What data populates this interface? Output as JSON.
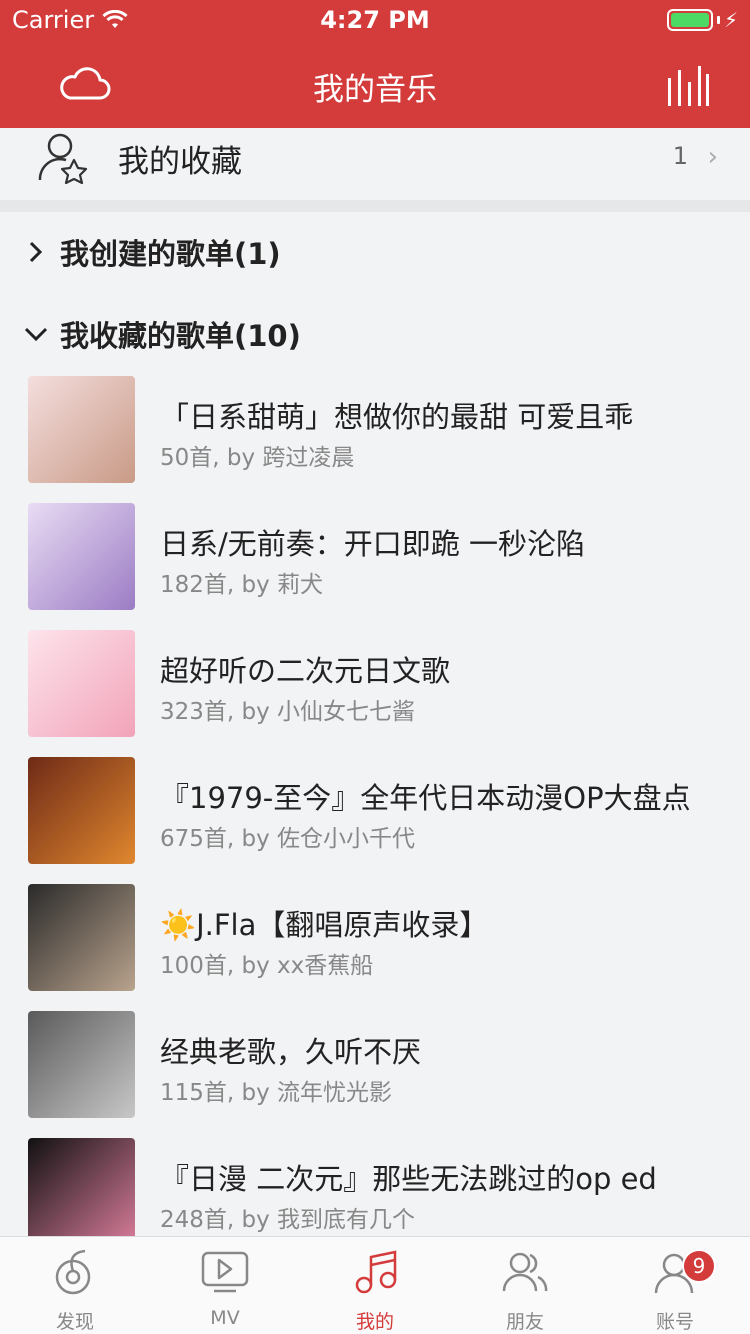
{
  "status": {
    "carrier": "Carrier",
    "time": "4:27 PM"
  },
  "nav": {
    "title": "我的音乐"
  },
  "favorites": {
    "label": "我的收藏",
    "count": "1"
  },
  "sections": {
    "created": "我创建的歌单(1)",
    "collected": "我收藏的歌单(10)"
  },
  "playlists": [
    {
      "title": "「日系甜萌」想做你的最甜 可爱且乖",
      "sub": "50首, by 跨过凌晨",
      "cover_colors": [
        "#f4dede",
        "#c99a86"
      ]
    },
    {
      "title": "日系/无前奏：开口即跪 一秒沦陷",
      "sub": "182首, by 莉犬",
      "cover_colors": [
        "#e9dcf4",
        "#9b7cc4"
      ]
    },
    {
      "title": "超好听の二次元日文歌",
      "sub": "323首, by 小仙女七七酱",
      "cover_colors": [
        "#fde4ec",
        "#f2a3b9"
      ]
    },
    {
      "title": "『1979-至今』全年代日本动漫OP大盘点",
      "sub": "675首, by 佐仓小小千代",
      "cover_colors": [
        "#6e2a17",
        "#e0872e"
      ]
    },
    {
      "title": "☀️J.Fla【翻唱原声收录】",
      "sub": "100首, by xx香蕉船",
      "cover_colors": [
        "#2a2a2a",
        "#b9a38d"
      ]
    },
    {
      "title": "经典老歌，久听不厌",
      "sub": "115首, by 流年忧光影",
      "cover_colors": [
        "#5a5a5a",
        "#c8c8c8"
      ]
    },
    {
      "title": "『日漫 二次元』那些无法跳过的op ed",
      "sub": "248首, by 我到底有几个",
      "cover_colors": [
        "#111111",
        "#d97c9a"
      ]
    }
  ],
  "tabs": [
    {
      "label": "发现",
      "icon": "discover-icon"
    },
    {
      "label": "MV",
      "icon": "mv-play-icon"
    },
    {
      "label": "我的",
      "icon": "music-note-icon"
    },
    {
      "label": "朋友",
      "icon": "friends-icon"
    },
    {
      "label": "账号",
      "icon": "account-icon",
      "badge": "9"
    }
  ],
  "colors": {
    "brand": "#d43c3c",
    "background": "#f2f3f5"
  }
}
